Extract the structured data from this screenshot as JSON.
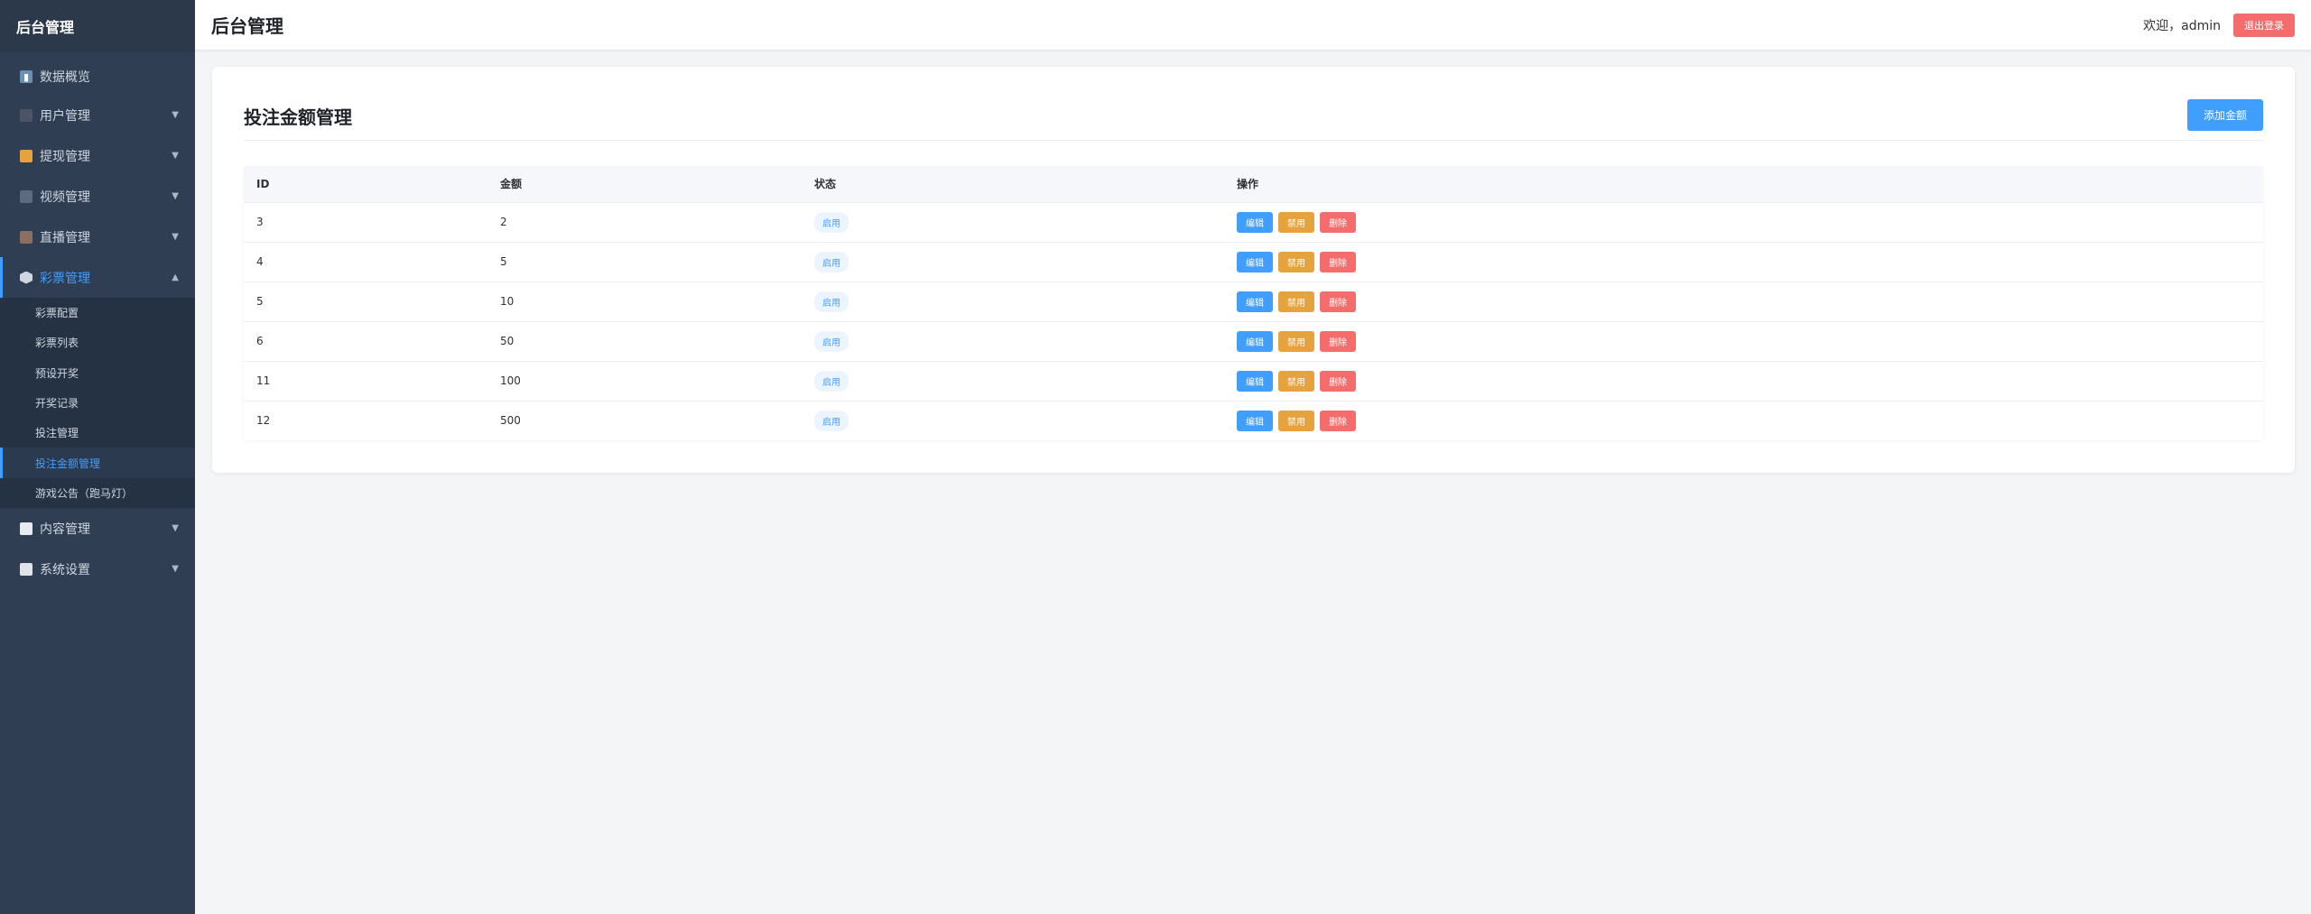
{
  "sidebar": {
    "brand": "后台管理",
    "items": [
      {
        "label": "数据概览",
        "icon": "chart-icon",
        "has_caret": false
      },
      {
        "label": "用户管理",
        "icon": "user-icon",
        "has_caret": true
      },
      {
        "label": "提现管理",
        "icon": "money-bag-icon",
        "has_caret": true
      },
      {
        "label": "视频管理",
        "icon": "video-icon",
        "has_caret": true
      },
      {
        "label": "直播管理",
        "icon": "tv-icon",
        "has_caret": true
      },
      {
        "label": "彩票管理",
        "icon": "cube-icon",
        "has_caret": true,
        "expanded": true,
        "active": true
      },
      {
        "label": "内容管理",
        "icon": "document-icon",
        "has_caret": true
      },
      {
        "label": "系统设置",
        "icon": "gear-icon",
        "has_caret": true
      }
    ],
    "submenu": [
      {
        "label": "彩票配置"
      },
      {
        "label": "彩票列表"
      },
      {
        "label": "预设开奖"
      },
      {
        "label": "开奖记录"
      },
      {
        "label": "投注管理"
      },
      {
        "label": "投注金额管理",
        "active": true
      },
      {
        "label": "游戏公告（跑马灯）"
      }
    ]
  },
  "header": {
    "title": "后台管理",
    "welcome": "欢迎，admin",
    "logout_label": "退出登录"
  },
  "page": {
    "title": "投注金额管理",
    "add_label": "添加金额"
  },
  "table": {
    "columns": [
      "ID",
      "金额",
      "状态",
      "操作"
    ],
    "rows": [
      {
        "id": "3",
        "amount": "2",
        "status": "启用"
      },
      {
        "id": "4",
        "amount": "5",
        "status": "启用"
      },
      {
        "id": "5",
        "amount": "10",
        "status": "启用"
      },
      {
        "id": "6",
        "amount": "50",
        "status": "启用"
      },
      {
        "id": "11",
        "amount": "100",
        "status": "启用"
      },
      {
        "id": "12",
        "amount": "500",
        "status": "启用"
      }
    ],
    "actions": {
      "edit": "编辑",
      "disable": "禁用",
      "delete": "删除"
    }
  },
  "colors": {
    "sidebar_bg": "#2f3e52",
    "accent": "#409eff",
    "warning": "#e6a23c",
    "danger": "#f56c6c"
  }
}
